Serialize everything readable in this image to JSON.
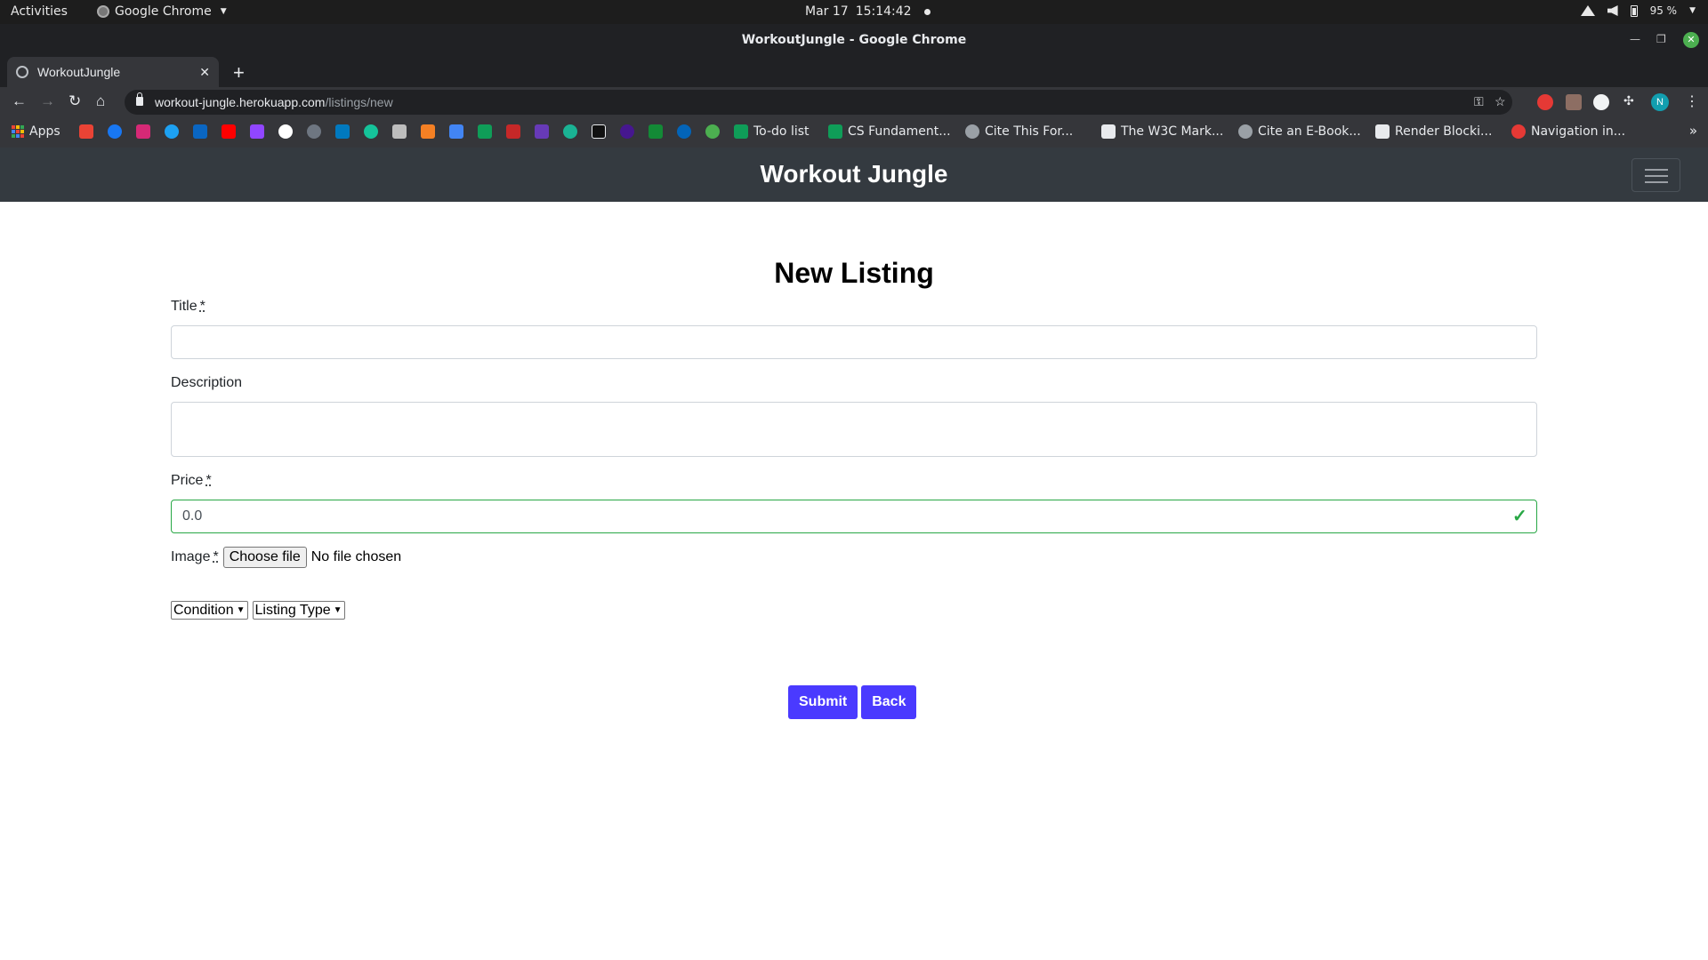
{
  "os_bar": {
    "activities": "Activities",
    "app_name": "Google Chrome",
    "date": "Mar 17",
    "time": "15:14:42",
    "battery": "95 %"
  },
  "window": {
    "title": "WorkoutJungle - Google Chrome"
  },
  "tabs": [
    {
      "label": "WorkoutJungle"
    }
  ],
  "address_bar": {
    "host": "workout-jungle.herokuapp.com",
    "path": "/listings/new"
  },
  "profile_initial": "N",
  "bookmarks": {
    "apps_label": "Apps",
    "icon_bookmarks": [
      "gmail",
      "facebook",
      "instagram",
      "twitter",
      "linkedin",
      "youtube",
      "twitch",
      "google",
      "github",
      "trello",
      "grammarly",
      "notes",
      "stackoverflow",
      "docs",
      "sheets",
      "calendar",
      "forms",
      "kite",
      "notion",
      "kahoot",
      "overleaf",
      "onedrive",
      "shield"
    ],
    "named": [
      {
        "label": "To-do list"
      },
      {
        "label": "CS Fundament..."
      },
      {
        "label": "Cite This For..."
      },
      {
        "label": "The W3C Mark..."
      },
      {
        "label": "Cite an E-Book..."
      },
      {
        "label": "Render Blocki..."
      },
      {
        "label": "Navigation in..."
      }
    ]
  },
  "site": {
    "brand": "Workout Jungle",
    "heading": "New Listing",
    "form": {
      "title_label": "Title",
      "title_value": "",
      "description_label": "Description",
      "description_value": "",
      "price_label": "Price",
      "price_value": "0.0",
      "required_marker": "*",
      "image_label": "Image",
      "file_button": "Choose file",
      "file_status": "No file chosen",
      "condition_select": "Condition",
      "listing_type_select": "Listing Type",
      "submit_label": "Submit",
      "back_label": "Back"
    }
  },
  "colors": {
    "navbar_bg": "#343a40",
    "button_bg": "#4a3aff",
    "valid_green": "#28a745"
  }
}
